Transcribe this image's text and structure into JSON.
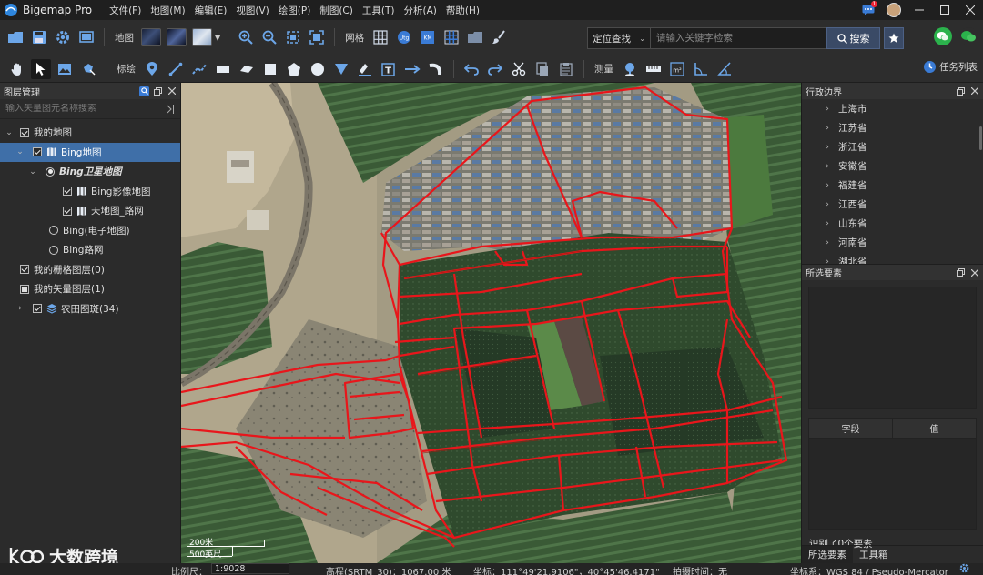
{
  "app": {
    "name": "Bigemap Pro",
    "menu": [
      "文件(F)",
      "地图(M)",
      "编辑(E)",
      "视图(V)",
      "绘图(P)",
      "制图(C)",
      "工具(T)",
      "分析(A)",
      "帮助(H)"
    ],
    "message_badge": "1"
  },
  "toolbar1": {
    "map_label": "地图",
    "grid_label": "网格",
    "search_mode": "定位查找",
    "search_placeholder": "请输入关键字检索",
    "search_button": "搜索"
  },
  "toolbar2": {
    "annotate_label": "标绘",
    "measure_label": "测量",
    "task_list": "任务列表"
  },
  "layer_panel": {
    "title": "图层管理",
    "search_placeholder": "输入矢量图元名称搜索",
    "tree": [
      {
        "label": "我的地图"
      },
      {
        "label": "Bing地图"
      },
      {
        "label": "Bing卫星地图"
      },
      {
        "label": "Bing影像地图"
      },
      {
        "label": "天地图_路网"
      },
      {
        "label": "Bing(电子地图)"
      },
      {
        "label": "Bing路网"
      },
      {
        "label": "我的栅格图层(0)"
      },
      {
        "label": "我的矢量图层(1)"
      },
      {
        "label": "农田图斑(34)"
      }
    ]
  },
  "admin_panel": {
    "title": "行政边界",
    "items": [
      "上海市",
      "江苏省",
      "浙江省",
      "安徽省",
      "福建省",
      "江西省",
      "山东省",
      "河南省",
      "湖北省"
    ]
  },
  "selected_panel": {
    "title": "所选要素",
    "col_field": "字段",
    "col_value": "值",
    "recognized": "识别了0个要素",
    "tab_selected": "所选要素",
    "tab_toolbox": "工具箱"
  },
  "map": {
    "scale_top": "200米",
    "scale_bottom": "500英尺",
    "watermark": "大数跨境"
  },
  "statusbar": {
    "scale_label": "比例尺：",
    "scale_value": "1:9028",
    "elevation": "高程(SRTM_30)：1067.00 米",
    "coords": "坐标：111°49'21.9106\"，40°45'46.4171\"",
    "capture_time": "拍摄时间：无",
    "crs": "坐标系：WGS 84 / Pseudo-Mercator"
  },
  "colors": {
    "accent_blue": "#3f6fa8",
    "parcel_red": "#e8161b",
    "panel_bg": "#2b2b2b"
  }
}
